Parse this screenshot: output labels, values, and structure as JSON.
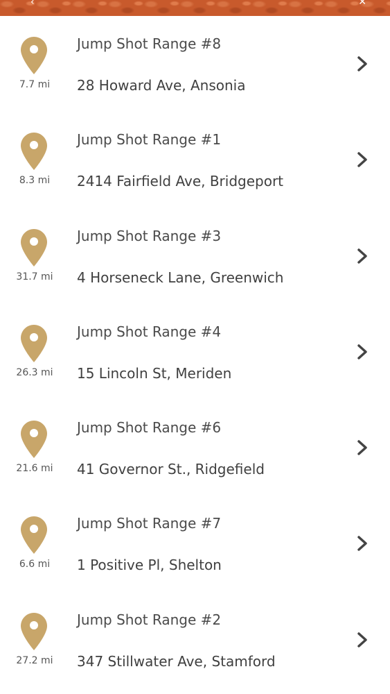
{
  "header": {
    "accent_color": "#c85a2c",
    "back_icon": "chevron-left-icon",
    "close_icon": "close-icon"
  },
  "colors": {
    "pin": "#c8a66a",
    "chevron": "#444444"
  },
  "locations": [
    {
      "name": "Jump Shot Range #8",
      "address": "28 Howard Ave, Ansonia",
      "distance": "7.7 mi"
    },
    {
      "name": "Jump Shot Range #1",
      "address": "2414 Fairfield Ave, Bridgeport",
      "distance": "8.3 mi"
    },
    {
      "name": "Jump Shot Range #3",
      "address": "4 Horseneck Lane, Greenwich",
      "distance": "31.7 mi"
    },
    {
      "name": "Jump Shot Range #4",
      "address": "15 Lincoln St, Meriden",
      "distance": "26.3 mi"
    },
    {
      "name": "Jump Shot Range #6",
      "address": "41 Governor St., Ridgefield",
      "distance": "21.6 mi"
    },
    {
      "name": "Jump Shot Range #7",
      "address": "1 Positive Pl, Shelton",
      "distance": "6.6 mi"
    },
    {
      "name": "Jump Shot Range #2",
      "address": "347 Stillwater Ave, Stamford",
      "distance": "27.2 mi"
    }
  ]
}
